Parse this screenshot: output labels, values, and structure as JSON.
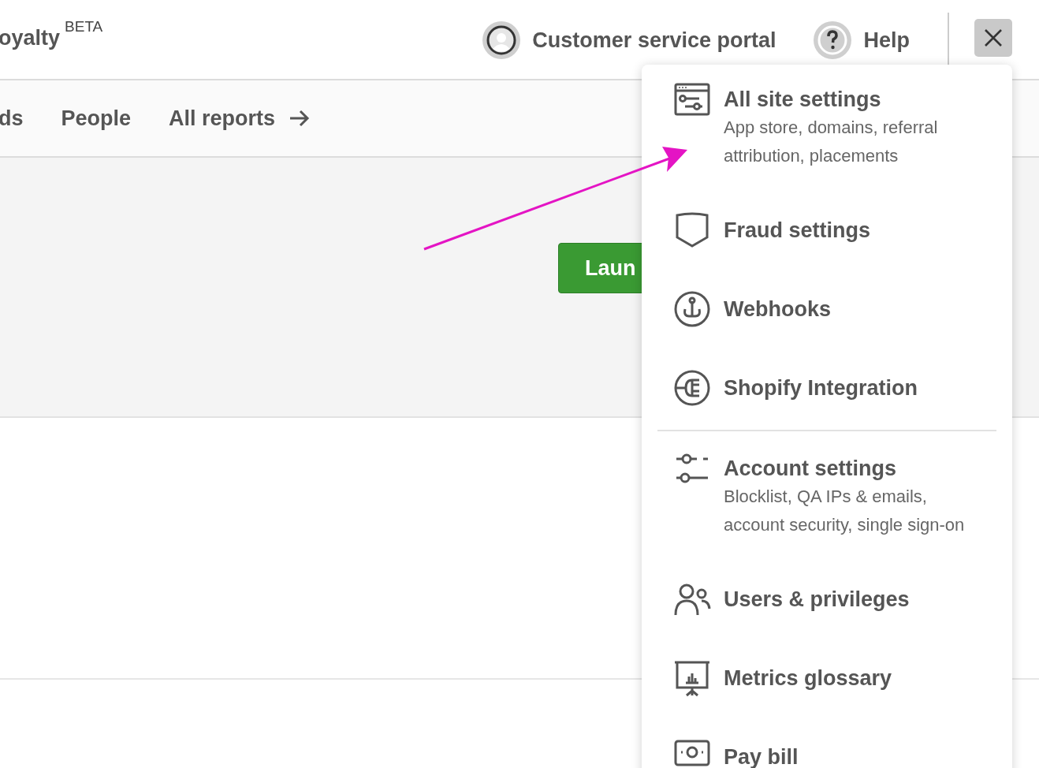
{
  "header": {
    "brand": "oyalty",
    "brand_badge": "BETA",
    "links": [
      {
        "kind": "portal",
        "label": "Customer service portal"
      },
      {
        "kind": "help",
        "label": "Help"
      }
    ]
  },
  "nav": {
    "items": [
      {
        "label": "ds",
        "kind": "link"
      },
      {
        "label": "People",
        "kind": "link"
      },
      {
        "label": "All reports",
        "kind": "arrow"
      }
    ]
  },
  "hero": {
    "button": "Laun"
  },
  "menu": {
    "groups": [
      [
        {
          "title": "All site settings",
          "description": "App store, domains, referral attribution, placements"
        },
        {
          "title": "Fraud settings"
        },
        {
          "title": "Webhooks"
        },
        {
          "title": "Shopify Integration"
        }
      ],
      [
        {
          "title": "Account settings",
          "description": "Blocklist, QA IPs & emails, account security, single sign-on"
        },
        {
          "title": "Users & privileges"
        },
        {
          "title": "Metrics glossary"
        },
        {
          "title": "Pay bill"
        }
      ]
    ]
  }
}
